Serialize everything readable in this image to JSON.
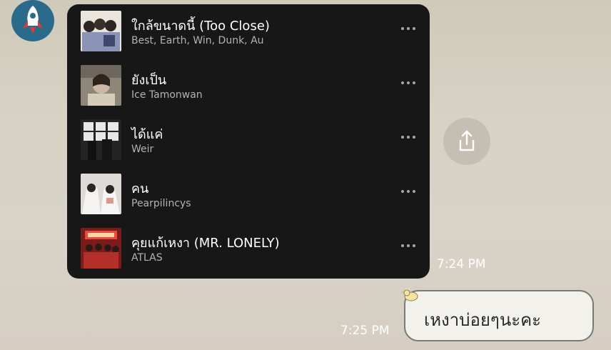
{
  "colors": {
    "card_bg": "#171717",
    "title": "#ffffff",
    "artist": "#b3b3b3",
    "bubble_bg": "#f3f1ec",
    "share_bg": "#c4bfb2",
    "avatar_bg": "#2a6a8a"
  },
  "playlist": {
    "tracks": [
      {
        "title": "ใกล้ขนาดนี้ (Too Close)",
        "artist": "Best, Earth, Win, Dunk, Au"
      },
      {
        "title": "ยังเป็น",
        "artist": "Ice Tamonwan"
      },
      {
        "title": "ได้แค่",
        "artist": "Weir"
      },
      {
        "title": "คน",
        "artist": "Pearpilincys"
      },
      {
        "title": "คุยแก้เหงา (MR. LONELY)",
        "artist": "ATLAS"
      }
    ]
  },
  "icons": {
    "avatar": "rocket-icon",
    "more": "more-dots-icon",
    "share": "share-icon"
  },
  "messages": {
    "playlist_time": "7:24 PM",
    "reply_time": "7:25 PM",
    "reply_text": "เหงาบ่อยๆนะคะ"
  }
}
